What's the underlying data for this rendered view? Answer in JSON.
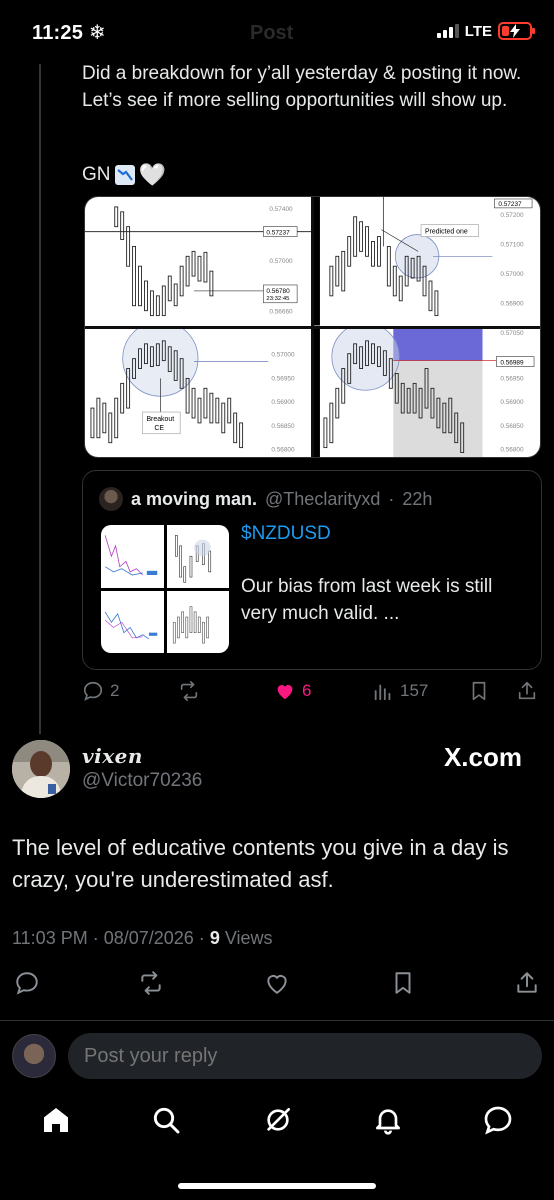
{
  "status": {
    "time": "11:25",
    "network": "LTE",
    "ghost_title": "Post"
  },
  "tweet": {
    "text": "Did a breakdown for y’all yesterday & posting it now. Let’s see if more selling opportunities will show up.",
    "sign_off": "GN",
    "media_labels": {
      "p1": "0.57400",
      "p2": "0.57237",
      "p3": "0.57000",
      "p4": "0.56780",
      "p4_time": "23:32:45",
      "p5": "0.56660",
      "predicted": "Predicted one",
      "q1": "0.57237",
      "q2": "0.57200",
      "q3": "0.57100",
      "q4": "0.57000",
      "q5": "0.56900",
      "breakout": "Breakout",
      "ce": "CE",
      "b1": "0.57000",
      "b2": "0.56950",
      "b3": "0.56900",
      "b4": "0.56850",
      "b5": "0.56800",
      "d1": "0.57050",
      "d2": "0.56989",
      "d3": "0.56950",
      "d4": "0.56900",
      "d5": "0.56850",
      "d6": "0.56800"
    },
    "quote": {
      "name": "a moving man.",
      "handle": "@Theclarityxd",
      "dot": "·",
      "age": "22h",
      "ticker": "$NZDUSD",
      "text": "Our bias from last week is still very much valid. ..."
    },
    "actions": {
      "replies": "2",
      "likes": "6",
      "views": "157"
    }
  },
  "reply": {
    "name": "vixen",
    "handle": "@Victor70236",
    "source": "X.com",
    "text": "The level of educative contents you give in a day is crazy, you're underestimated asf.",
    "time": "11:03 PM · 08/07/2026 ·",
    "views_count": "9",
    "views_label": "Views"
  },
  "composer": {
    "placeholder": "Post your reply"
  },
  "colors": {
    "accent": "#1d9bf0",
    "like": "#f91880",
    "muted": "#71767b"
  }
}
